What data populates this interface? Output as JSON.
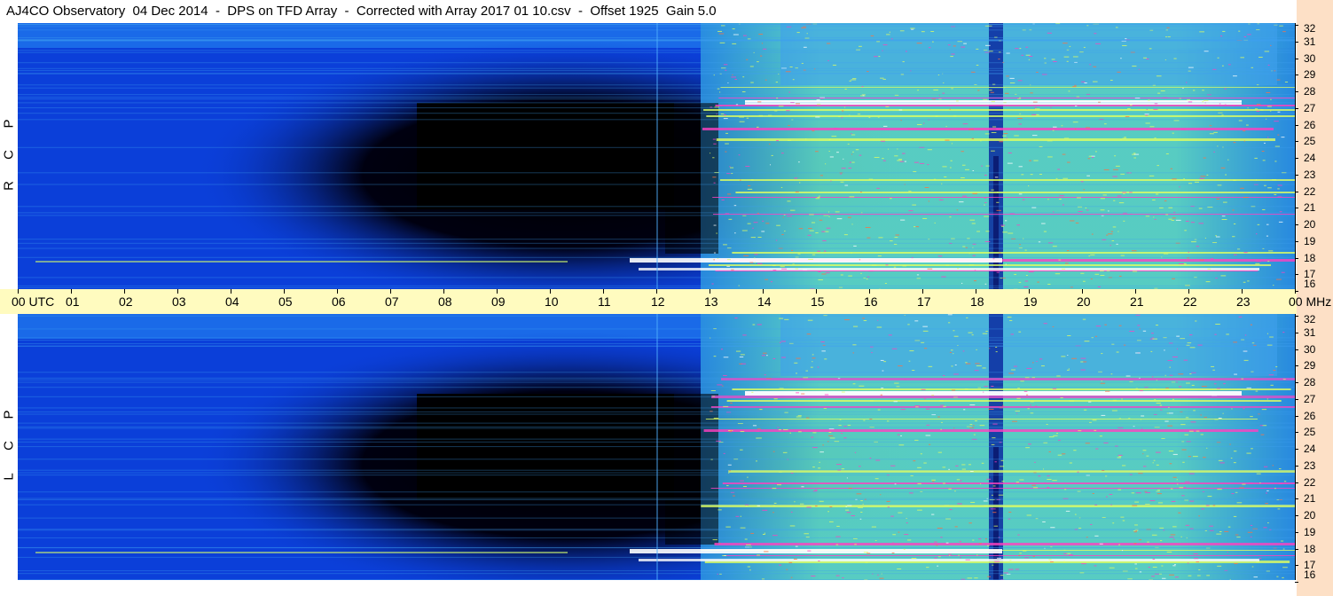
{
  "title": "AJ4CO Observatory  04 Dec 2014  -  DPS on TFD Array  -  Corrected with Array 2017 01 10.csv  -  Offset 1925  Gain 5.0",
  "panels": [
    {
      "id": "rcp",
      "letters": [
        "P",
        "C",
        "R"
      ]
    },
    {
      "id": "lcp",
      "letters": [
        "P",
        "C",
        "L"
      ]
    }
  ],
  "time_axis": {
    "labels": [
      "00",
      "01",
      "02",
      "03",
      "04",
      "05",
      "06",
      "07",
      "08",
      "09",
      "10",
      "11",
      "12",
      "13",
      "14",
      "15",
      "16",
      "17",
      "18",
      "19",
      "20",
      "21",
      "22",
      "23",
      "00"
    ],
    "unit": "UTC"
  },
  "freq_axis": {
    "labels": [
      "32",
      "31",
      "30",
      "29",
      "28",
      "27",
      "26",
      "25",
      "24",
      "23",
      "22",
      "21",
      "20",
      "19",
      "18",
      "17",
      "16"
    ],
    "unit": "MHz"
  },
  "colors": {
    "quiet": "#0b3fd9",
    "dark": "#000000",
    "band": "#7fe0c8",
    "hot": "#e0ff60",
    "peak": "#ff40c0",
    "sat": "#ffffff",
    "axis_bg": "#fffbbf",
    "right_bg": "#fde0c6"
  },
  "chart_data": {
    "type": "heatmap",
    "title": "AJ4CO Observatory  04 Dec 2014  -  DPS on TFD Array  -  Corrected with Array 2017 01 10.csv  -  Offset 1925  Gain 5.0",
    "x_range_utc_hours": [
      0,
      24
    ],
    "y_range_mhz": [
      16,
      32
    ],
    "panels": [
      "RCP",
      "LCP"
    ]
  }
}
